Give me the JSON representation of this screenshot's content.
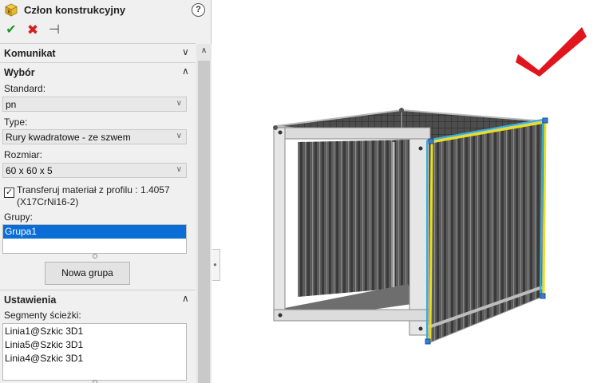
{
  "panel": {
    "title": "Człon konstrukcyjny",
    "help": "?",
    "actions": {
      "ok": "✔",
      "cancel": "✖",
      "pin": "⊣"
    }
  },
  "sections": {
    "message": {
      "title": "Komunikat"
    },
    "selection": {
      "title": "Wybór",
      "standard_label": "Standard:",
      "standard_value": "pn",
      "type_label": "Type:",
      "type_value": "Rury kwadratowe - ze szwem",
      "size_label": "Rozmiar:",
      "size_value": "60 x 60 x 5",
      "transfer_checked": true,
      "transfer_label": "Transferuj materiał z profilu : 1.4057 (X17CrNi16-2)",
      "groups_label": "Grupy:",
      "groups": [
        "Grupa1"
      ],
      "new_group_button": "Nowa grupa"
    },
    "settings": {
      "title": "Ustawienia",
      "segments_label": "Segmenty ścieżki:",
      "segments": [
        "Linia1@Szkic 3D1",
        "Linia5@Szkic 3D1",
        "Linia4@Szkic 3D1"
      ]
    }
  },
  "icons": {
    "feature": "structural-member-icon",
    "chevron_expanded": "chevron-up-icon",
    "chevron_collapsed": "chevron-down-icon",
    "confirm_corner": "checkmark-icon"
  },
  "colors": {
    "ok_green": "#1c9a2a",
    "cancel_red": "#d42020",
    "selection_blue": "#0a6ed6",
    "confirm_red": "#e0151d",
    "highlight_yellow": "#e8e020",
    "highlight_cyan": "#31b0d8"
  }
}
